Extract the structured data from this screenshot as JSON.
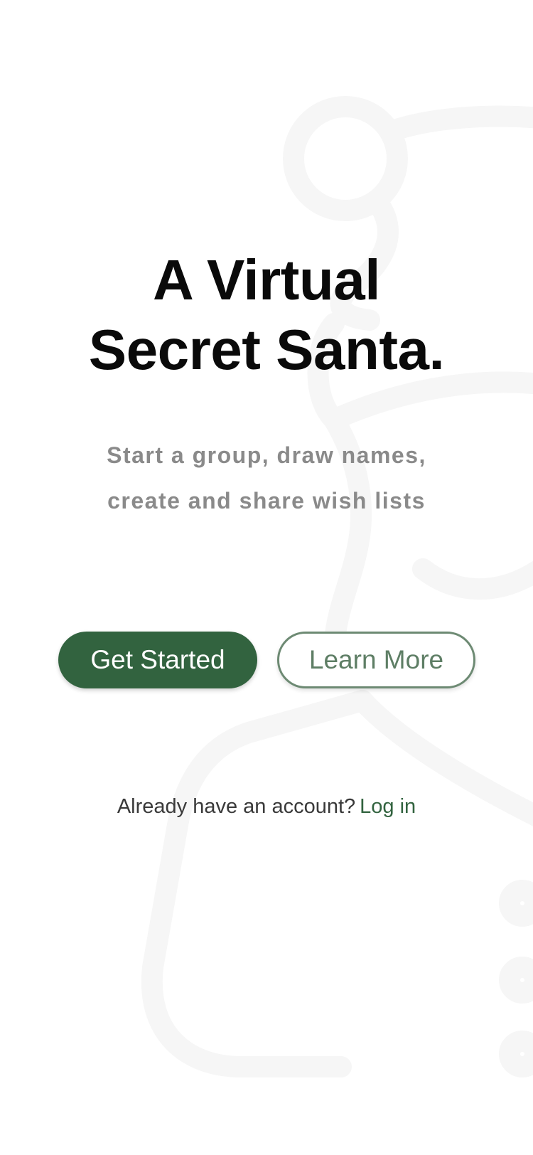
{
  "hero": {
    "title_line_1": "A Virtual",
    "title_line_2": "Secret Santa."
  },
  "subtitle": {
    "line_1": "Start a group, draw names,",
    "line_2": "create and share wish lists"
  },
  "actions": {
    "primary_label": "Get Started",
    "secondary_label": "Learn More"
  },
  "login": {
    "prompt": "Already have an account?",
    "link_label": "Log in"
  },
  "colors": {
    "brand_green": "#32633f",
    "outline_green": "#6d8a73",
    "subtitle_gray": "#8a8a8a",
    "illustration_stroke": "#f6f6f6"
  },
  "icons": {
    "background": "santa-outline-illustration"
  }
}
